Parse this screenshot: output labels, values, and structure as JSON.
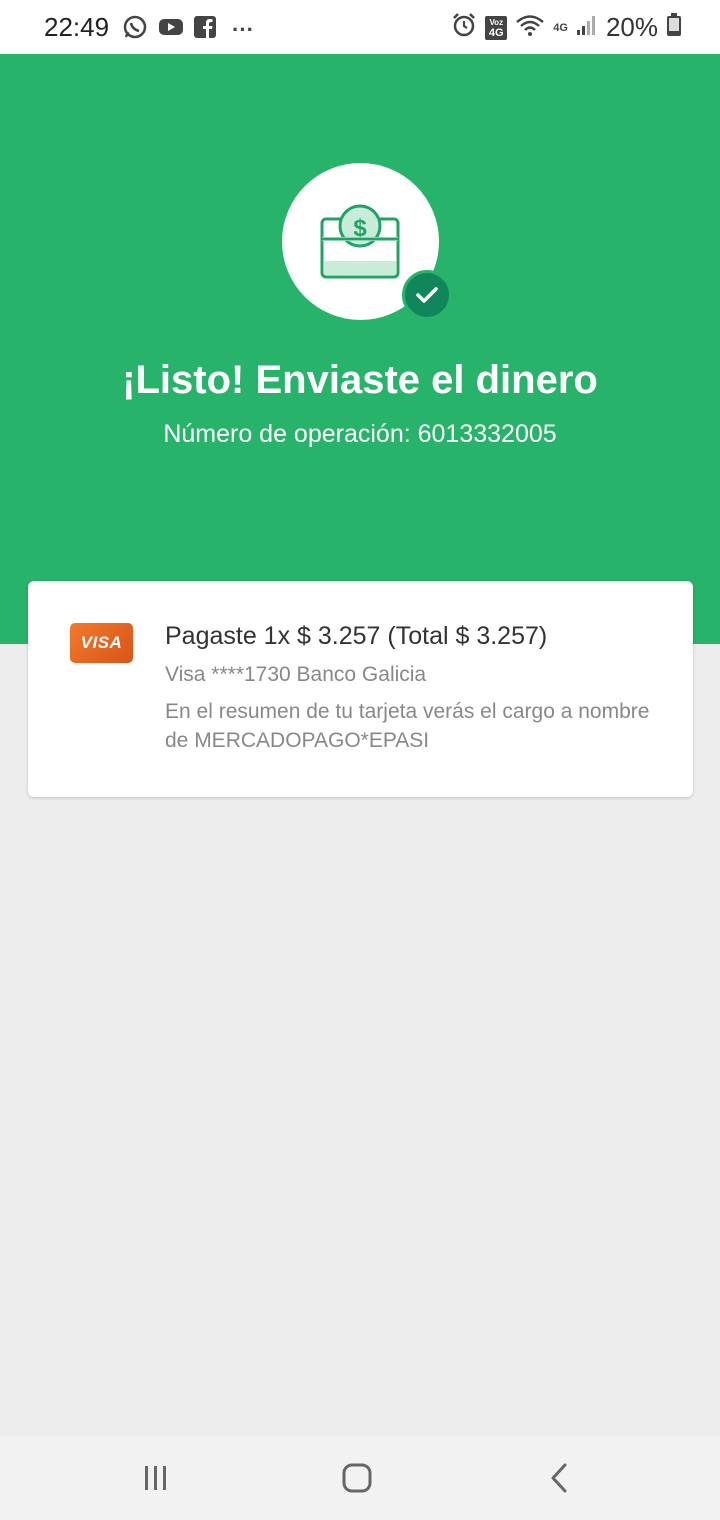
{
  "status_bar": {
    "time": "22:49",
    "more": "···",
    "battery_percent": "20%",
    "network": "4G",
    "volte_top": "Voz",
    "volte_bottom": "4G",
    "left_icons": [
      "whatsapp-icon",
      "youtube-icon",
      "facebook-icon"
    ],
    "right_icons": [
      "alarm-icon",
      "volte-icon",
      "wifi-icon",
      "signal-icon",
      "battery-icon"
    ]
  },
  "colors": {
    "header_green": "#28b36a",
    "badge_green": "#11865a",
    "visa_orange": "#e8641f",
    "background": "#ededed"
  },
  "success": {
    "headline": "¡Listo! Enviaste el dinero",
    "operation_number": "Número de operación: 6013332005",
    "icon": "money-bag-icon",
    "badge_icon": "check-icon"
  },
  "payment": {
    "card_brand": "VISA",
    "title": "Pagaste 1x $ 3.257 (Total $ 3.257)",
    "card_detail": "Visa ****1730 Banco Galicia",
    "statement_note": "En el resumen de tu tarjeta verás el cargo a nombre de MERCADOPAGO*EPASI"
  },
  "nav": {
    "items": [
      "recent-apps-icon",
      "home-icon",
      "back-icon"
    ]
  }
}
